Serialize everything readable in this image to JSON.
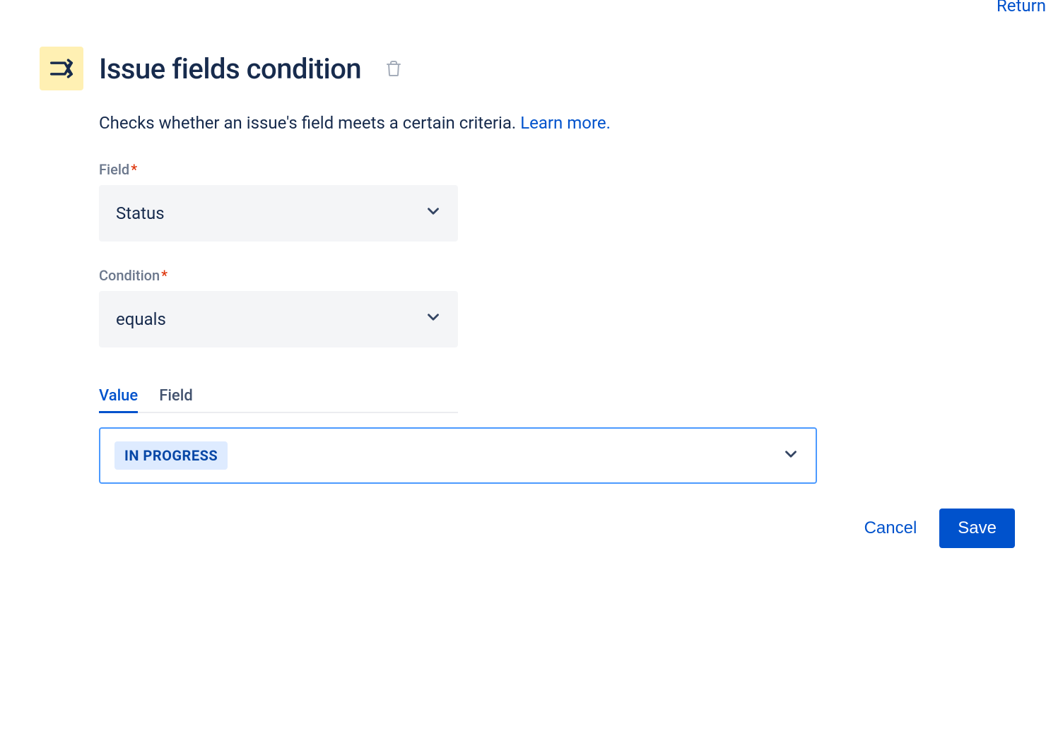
{
  "top_link": "Return",
  "header": {
    "title": "Issue fields condition"
  },
  "description": {
    "text": "Checks whether an issue's field meets a certain criteria. ",
    "learn_more": "Learn more."
  },
  "form": {
    "field_label": "Field",
    "field_value": "Status",
    "condition_label": "Condition",
    "condition_value": "equals"
  },
  "tabs": {
    "value": "Value",
    "field": "Field"
  },
  "value_select": {
    "selected": "IN PROGRESS"
  },
  "footer": {
    "cancel": "Cancel",
    "save": "Save"
  }
}
